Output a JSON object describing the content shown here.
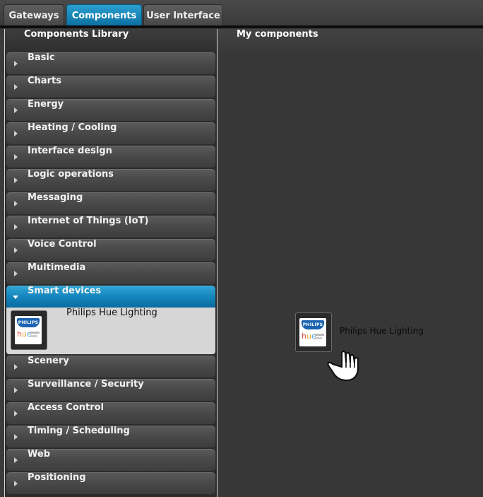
{
  "tabs": [
    {
      "label": "Gateways",
      "active": false
    },
    {
      "label": "Components",
      "active": true
    },
    {
      "label": "User Interface",
      "active": false
    }
  ],
  "library": {
    "title": "Components Library",
    "categories": [
      {
        "label": "Basic"
      },
      {
        "label": "Charts"
      },
      {
        "label": "Energy"
      },
      {
        "label": "Heating / Cooling"
      },
      {
        "label": "Interface design"
      },
      {
        "label": "Logic operations"
      },
      {
        "label": "Messaging"
      },
      {
        "label": "Internet of Things (IoT)"
      },
      {
        "label": "Voice Control"
      },
      {
        "label": "Multimedia"
      },
      {
        "label": "Smart devices",
        "expanded": true
      },
      {
        "label": "Scenery"
      },
      {
        "label": "Surveillance / Security"
      },
      {
        "label": "Access Control"
      },
      {
        "label": "Timing / Scheduling"
      },
      {
        "label": "Web"
      },
      {
        "label": "Positioning"
      }
    ],
    "smart_devices_items": [
      {
        "label": "Philips Hue Lighting",
        "icon": "philips-hue-icon",
        "logo_brand": "PHILIPS",
        "logo_product": "hue"
      }
    ]
  },
  "my_components": {
    "title": "My components",
    "dragged_item": {
      "label": "Philips Hue Lighting",
      "icon": "philips-hue-icon",
      "logo_brand": "PHILIPS",
      "logo_product": "hue"
    },
    "cursor": "grab-hand-cursor"
  },
  "colors": {
    "accent": "#1486bd",
    "background": "#373737",
    "category_bar": "#4a4a4a",
    "selected_item_bg": "#d6d6d6"
  }
}
